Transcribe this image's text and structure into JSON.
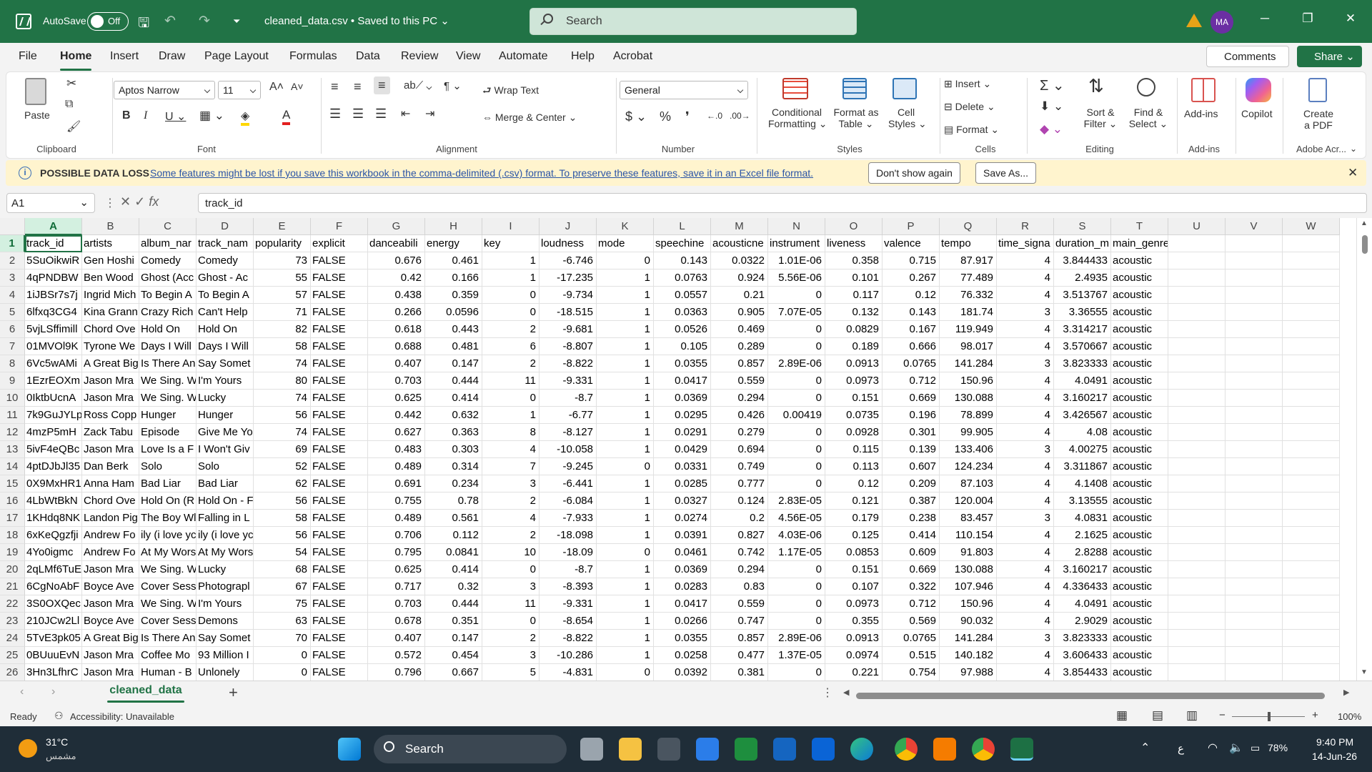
{
  "titlebar": {
    "autosave_label": "AutoSave",
    "autosave_state": "Off",
    "file_title": "cleaned_data.csv • Saved to this PC ⌄",
    "search_placeholder": "Search",
    "user_initials": "MA",
    "brand_color": "#217346"
  },
  "menu": [
    "File",
    "Home",
    "Insert",
    "Draw",
    "Page Layout",
    "Formulas",
    "Data",
    "Review",
    "View",
    "Automate",
    "Help",
    "Acrobat"
  ],
  "menu_active": "Home",
  "actions": {
    "comments": "Comments",
    "share": "Share"
  },
  "ribbon": {
    "clipboard": {
      "paste": "Paste",
      "label": "Clipboard"
    },
    "font": {
      "name": "Aptos Narrow",
      "size": "11",
      "label": "Font"
    },
    "alignment": {
      "wrap": "Wrap Text",
      "merge": "Merge & Center",
      "label": "Alignment"
    },
    "number": {
      "format": "General",
      "label": "Number"
    },
    "styles": {
      "conditional": "Conditional",
      "conditional2": "Formatting",
      "format_table": "Format as",
      "format_table2": "Table",
      "cell_styles": "Cell",
      "cell_styles2": "Styles",
      "label": "Styles"
    },
    "cells": {
      "insert": "Insert",
      "delete": "Delete",
      "format": "Format",
      "label": "Cells"
    },
    "editing": {
      "sort": "Sort &",
      "sort2": "Filter",
      "find": "Find &",
      "find2": "Select",
      "label": "Editing"
    },
    "addins": {
      "addins": "Add-ins",
      "label": "Add-ins"
    },
    "copilot": {
      "label": "Copilot"
    },
    "adobe": {
      "create": "Create",
      "create2": "a PDF",
      "label": "Adobe Acr..."
    }
  },
  "message_bar": {
    "title": "POSSIBLE DATA LOSS",
    "text": "Some features might be lost if you save this workbook in the comma-delimited (.csv) format. To preserve these features, save it in an Excel file format.",
    "btn_dont_show": "Don't show again",
    "btn_save_as": "Save As..."
  },
  "formula_bar": {
    "name_box": "A1",
    "content": "track_id"
  },
  "columns": [
    "A",
    "B",
    "C",
    "D",
    "E",
    "F",
    "G",
    "H",
    "I",
    "J",
    "K",
    "L",
    "M",
    "N",
    "O",
    "P",
    "Q",
    "R",
    "S",
    "T",
    "U",
    "V",
    "W"
  ],
  "row_numbers": [
    "1",
    "2",
    "3",
    "4",
    "5",
    "6",
    "7",
    "8",
    "9",
    "10",
    "11",
    "12",
    "13",
    "14",
    "15",
    "16",
    "17",
    "18",
    "19",
    "20",
    "21",
    "22",
    "23",
    "24",
    "25",
    "26"
  ],
  "header_row": [
    "track_id",
    "artists",
    "album_nar",
    "track_nam",
    "popularity",
    "explicit",
    "danceabili",
    "energy",
    "key",
    "loudness",
    "mode",
    "speechine",
    "acousticne",
    "instrument",
    "liveness",
    "valence",
    "tempo",
    "time_signa",
    "duration_m",
    "main_genre"
  ],
  "rows": [
    [
      "5SuOikwiR",
      "Gen Hoshi",
      "Comedy",
      "Comedy",
      "73",
      "FALSE",
      "0.676",
      "0.461",
      "1",
      "-6.746",
      "0",
      "0.143",
      "0.0322",
      "1.01E-06",
      "0.358",
      "0.715",
      "87.917",
      "4",
      "3.844433",
      "acoustic"
    ],
    [
      "4qPNDBW",
      "Ben Wood",
      "Ghost (Acc",
      "Ghost - Ac",
      "55",
      "FALSE",
      "0.42",
      "0.166",
      "1",
      "-17.235",
      "1",
      "0.0763",
      "0.924",
      "5.56E-06",
      "0.101",
      "0.267",
      "77.489",
      "4",
      "2.4935",
      "acoustic"
    ],
    [
      "1iJBSr7s7j",
      "Ingrid Mich",
      "To Begin A",
      "To Begin A",
      "57",
      "FALSE",
      "0.438",
      "0.359",
      "0",
      "-9.734",
      "1",
      "0.0557",
      "0.21",
      "0",
      "0.117",
      "0.12",
      "76.332",
      "4",
      "3.513767",
      "acoustic"
    ],
    [
      "6lfxq3CG4",
      "Kina Grann",
      "Crazy Rich",
      "Can't Help",
      "71",
      "FALSE",
      "0.266",
      "0.0596",
      "0",
      "-18.515",
      "1",
      "0.0363",
      "0.905",
      "7.07E-05",
      "0.132",
      "0.143",
      "181.74",
      "3",
      "3.36555",
      "acoustic"
    ],
    [
      "5vjLSffimill",
      "Chord Ove",
      "Hold On",
      "Hold On",
      "82",
      "FALSE",
      "0.618",
      "0.443",
      "2",
      "-9.681",
      "1",
      "0.0526",
      "0.469",
      "0",
      "0.0829",
      "0.167",
      "119.949",
      "4",
      "3.314217",
      "acoustic"
    ],
    [
      "01MVOl9K",
      "Tyrone We",
      "Days I Will",
      "Days I Will",
      "58",
      "FALSE",
      "0.688",
      "0.481",
      "6",
      "-8.807",
      "1",
      "0.105",
      "0.289",
      "0",
      "0.189",
      "0.666",
      "98.017",
      "4",
      "3.570667",
      "acoustic"
    ],
    [
      "6Vc5wAMi",
      "A Great Big",
      "Is There An",
      "Say Somet",
      "74",
      "FALSE",
      "0.407",
      "0.147",
      "2",
      "-8.822",
      "1",
      "0.0355",
      "0.857",
      "2.89E-06",
      "0.0913",
      "0.0765",
      "141.284",
      "3",
      "3.823333",
      "acoustic"
    ],
    [
      "1EzrEOXm",
      "Jason Mra",
      "We Sing. W",
      "I'm Yours",
      "80",
      "FALSE",
      "0.703",
      "0.444",
      "11",
      "-9.331",
      "1",
      "0.0417",
      "0.559",
      "0",
      "0.0973",
      "0.712",
      "150.96",
      "4",
      "4.0491",
      "acoustic"
    ],
    [
      "0IktbUcnA",
      "Jason Mra",
      "We Sing. W",
      "Lucky",
      "74",
      "FALSE",
      "0.625",
      "0.414",
      "0",
      "-8.7",
      "1",
      "0.0369",
      "0.294",
      "0",
      "0.151",
      "0.669",
      "130.088",
      "4",
      "3.160217",
      "acoustic"
    ],
    [
      "7k9GuJYLp",
      "Ross Copp",
      "Hunger",
      "Hunger",
      "56",
      "FALSE",
      "0.442",
      "0.632",
      "1",
      "-6.77",
      "1",
      "0.0295",
      "0.426",
      "0.00419",
      "0.0735",
      "0.196",
      "78.899",
      "4",
      "3.426567",
      "acoustic"
    ],
    [
      "4mzP5mH",
      "Zack Tabu",
      "Episode",
      "Give Me Yo",
      "74",
      "FALSE",
      "0.627",
      "0.363",
      "8",
      "-8.127",
      "1",
      "0.0291",
      "0.279",
      "0",
      "0.0928",
      "0.301",
      "99.905",
      "4",
      "4.08",
      "acoustic"
    ],
    [
      "5ivF4eQBc",
      "Jason Mra",
      "Love Is a F",
      "I Won't Giv",
      "69",
      "FALSE",
      "0.483",
      "0.303",
      "4",
      "-10.058",
      "1",
      "0.0429",
      "0.694",
      "0",
      "0.115",
      "0.139",
      "133.406",
      "3",
      "4.00275",
      "acoustic"
    ],
    [
      "4ptDJbJl35",
      "Dan Berk",
      "Solo",
      "Solo",
      "52",
      "FALSE",
      "0.489",
      "0.314",
      "7",
      "-9.245",
      "0",
      "0.0331",
      "0.749",
      "0",
      "0.113",
      "0.607",
      "124.234",
      "4",
      "3.311867",
      "acoustic"
    ],
    [
      "0X9MxHR1",
      "Anna Ham",
      "Bad Liar",
      "Bad Liar",
      "62",
      "FALSE",
      "0.691",
      "0.234",
      "3",
      "-6.441",
      "1",
      "0.0285",
      "0.777",
      "0",
      "0.12",
      "0.209",
      "87.103",
      "4",
      "4.1408",
      "acoustic"
    ],
    [
      "4LbWtBkN",
      "Chord Ove",
      "Hold On (R",
      "Hold On - F",
      "56",
      "FALSE",
      "0.755",
      "0.78",
      "2",
      "-6.084",
      "1",
      "0.0327",
      "0.124",
      "2.83E-05",
      "0.121",
      "0.387",
      "120.004",
      "4",
      "3.13555",
      "acoustic"
    ],
    [
      "1KHdq8NK",
      "Landon Pig",
      "The Boy Wl",
      "Falling in L",
      "58",
      "FALSE",
      "0.489",
      "0.561",
      "4",
      "-7.933",
      "1",
      "0.0274",
      "0.2",
      "4.56E-05",
      "0.179",
      "0.238",
      "83.457",
      "3",
      "4.0831",
      "acoustic"
    ],
    [
      "6xKeQgzfji",
      "Andrew Fo",
      "ily (i love yc",
      "ily (i love yc",
      "56",
      "FALSE",
      "0.706",
      "0.112",
      "2",
      "-18.098",
      "1",
      "0.0391",
      "0.827",
      "4.03E-06",
      "0.125",
      "0.414",
      "110.154",
      "4",
      "2.1625",
      "acoustic"
    ],
    [
      "4Yo0igmc",
      "Andrew Fo",
      "At My Wors",
      "At My Wors",
      "54",
      "FALSE",
      "0.795",
      "0.0841",
      "10",
      "-18.09",
      "0",
      "0.0461",
      "0.742",
      "1.17E-05",
      "0.0853",
      "0.609",
      "91.803",
      "4",
      "2.8288",
      "acoustic"
    ],
    [
      "2qLMf6TuE",
      "Jason Mra",
      "We Sing. W",
      "Lucky",
      "68",
      "FALSE",
      "0.625",
      "0.414",
      "0",
      "-8.7",
      "1",
      "0.0369",
      "0.294",
      "0",
      "0.151",
      "0.669",
      "130.088",
      "4",
      "3.160217",
      "acoustic"
    ],
    [
      "6CgNoAbF",
      "Boyce Ave",
      "Cover Sess",
      "Photograpl",
      "67",
      "FALSE",
      "0.717",
      "0.32",
      "3",
      "-8.393",
      "1",
      "0.0283",
      "0.83",
      "0",
      "0.107",
      "0.322",
      "107.946",
      "4",
      "4.336433",
      "acoustic"
    ],
    [
      "3S0OXQec",
      "Jason Mra",
      "We Sing. W",
      "I'm Yours",
      "75",
      "FALSE",
      "0.703",
      "0.444",
      "11",
      "-9.331",
      "1",
      "0.0417",
      "0.559",
      "0",
      "0.0973",
      "0.712",
      "150.96",
      "4",
      "4.0491",
      "acoustic"
    ],
    [
      "210JCw2Ll",
      "Boyce Ave",
      "Cover Sess",
      "Demons",
      "63",
      "FALSE",
      "0.678",
      "0.351",
      "0",
      "-8.654",
      "1",
      "0.0266",
      "0.747",
      "0",
      "0.355",
      "0.569",
      "90.032",
      "4",
      "2.9029",
      "acoustic"
    ],
    [
      "5TvE3pk05",
      "A Great Big",
      "Is There An",
      "Say Somet",
      "70",
      "FALSE",
      "0.407",
      "0.147",
      "2",
      "-8.822",
      "1",
      "0.0355",
      "0.857",
      "2.89E-06",
      "0.0913",
      "0.0765",
      "141.284",
      "3",
      "3.823333",
      "acoustic"
    ],
    [
      "0BUuuEvN",
      "Jason Mra",
      "Coffee Mo",
      "93 Million I",
      "0",
      "FALSE",
      "0.572",
      "0.454",
      "3",
      "-10.286",
      "1",
      "0.0258",
      "0.477",
      "1.37E-05",
      "0.0974",
      "0.515",
      "140.182",
      "4",
      "3.606433",
      "acoustic"
    ],
    [
      "3Hn3LfhrC",
      "Jason Mra",
      "Human - B",
      "Unlonely",
      "0",
      "FALSE",
      "0.796",
      "0.667",
      "5",
      "-4.831",
      "0",
      "0.0392",
      "0.381",
      "0",
      "0.221",
      "0.754",
      "97.988",
      "4",
      "3.854433",
      "acoustic"
    ]
  ],
  "numeric_columns": [
    4,
    6,
    7,
    8,
    9,
    10,
    11,
    12,
    13,
    14,
    15,
    16,
    17,
    18
  ],
  "sheet": {
    "tab": "cleaned_data",
    "add": "+"
  },
  "status": {
    "ready": "Ready",
    "accessibility": "Accessibility: Unavailable",
    "zoom": "100%"
  },
  "taskbar": {
    "weather_temp": "31°C",
    "weather_desc": "مشمس",
    "search": "Search",
    "battery": "78%",
    "time": "9:40 PM",
    "date": "14-Jun-26",
    "lang": "ع"
  }
}
